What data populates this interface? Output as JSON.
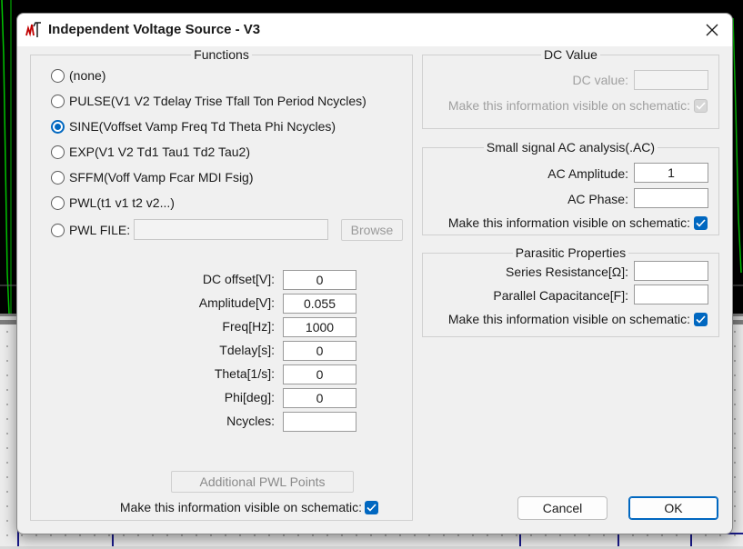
{
  "window": {
    "title": "Independent Voltage Source - V3"
  },
  "functions": {
    "legend": "Functions",
    "options": [
      {
        "label": "(none)",
        "selected": false
      },
      {
        "label": "PULSE(V1 V2 Tdelay Trise Tfall Ton Period Ncycles)",
        "selected": false
      },
      {
        "label": "SINE(Voffset Vamp Freq Td Theta Phi Ncycles)",
        "selected": true
      },
      {
        "label": "EXP(V1 V2 Td1 Tau1 Td2 Tau2)",
        "selected": false
      },
      {
        "label": "SFFM(Voff Vamp Fcar MDI Fsig)",
        "selected": false
      },
      {
        "label": "PWL(t1 v1 t2 v2...)",
        "selected": false
      },
      {
        "label": "PWL FILE:",
        "selected": false
      }
    ],
    "pwl_file_value": "",
    "browse_label": "Browse",
    "params": [
      {
        "label": "DC offset[V]:",
        "value": "0"
      },
      {
        "label": "Amplitude[V]:",
        "value": "0.055"
      },
      {
        "label": "Freq[Hz]:",
        "value": "1000"
      },
      {
        "label": "Tdelay[s]:",
        "value": "0"
      },
      {
        "label": "Theta[1/s]:",
        "value": "0"
      },
      {
        "label": "Phi[deg]:",
        "value": "0"
      },
      {
        "label": "Ncycles:",
        "value": ""
      }
    ],
    "additional_pwl_label": "Additional PWL Points",
    "visible_label": "Make this information visible on schematic:",
    "visible_checked": true
  },
  "dc_value": {
    "legend": "DC Value",
    "dc_label": "DC value:",
    "dc_value": "",
    "visible_label": "Make this information visible on schematic:",
    "visible_checked": true
  },
  "ac": {
    "legend": "Small signal AC analysis(.AC)",
    "amplitude_label": "AC Amplitude:",
    "amplitude_value": "1",
    "phase_label": "AC Phase:",
    "phase_value": "",
    "visible_label": "Make this information visible on schematic:",
    "visible_checked": true
  },
  "parasitic": {
    "legend": "Parasitic Properties",
    "series_label": "Series Resistance[Ω]:",
    "series_value": "",
    "parallel_label": "Parallel Capacitance[F]:",
    "parallel_value": "",
    "visible_label": "Make this information visible on schematic:",
    "visible_checked": true
  },
  "buttons": {
    "cancel": "Cancel",
    "ok": "OK"
  },
  "colors": {
    "accent": "#0067c0",
    "waveform": "#00c800"
  },
  "icons": {
    "app": "ltspice-logo-icon",
    "close": "close-icon",
    "check": "checkmark-icon"
  }
}
